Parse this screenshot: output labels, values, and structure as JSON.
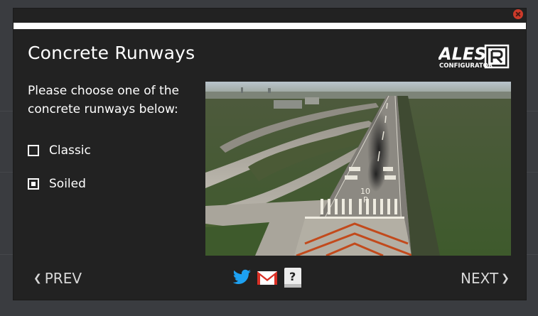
{
  "dialog": {
    "title": "Concrete Runways",
    "progress": 1.0,
    "prompt": "Please choose one of the concrete runways below:"
  },
  "logo": {
    "main": "ALES",
    "sub": "CONFIGURATOR",
    "badge": "R"
  },
  "options": [
    {
      "label": "Classic",
      "checked": false
    },
    {
      "label": "Soiled",
      "checked": true
    }
  ],
  "preview": {
    "runway_number": "10",
    "runway_letter": "R"
  },
  "footer": {
    "prev_label": "PREV",
    "next_label": "NEXT",
    "icons": [
      "twitter-icon",
      "gmail-icon",
      "help-book-icon"
    ]
  },
  "colors": {
    "dialog_bg": "#222222",
    "backdrop": "#3a3c40",
    "close": "#cc3a2a",
    "twitter": "#1da1f2",
    "gmail": "#d93025"
  }
}
